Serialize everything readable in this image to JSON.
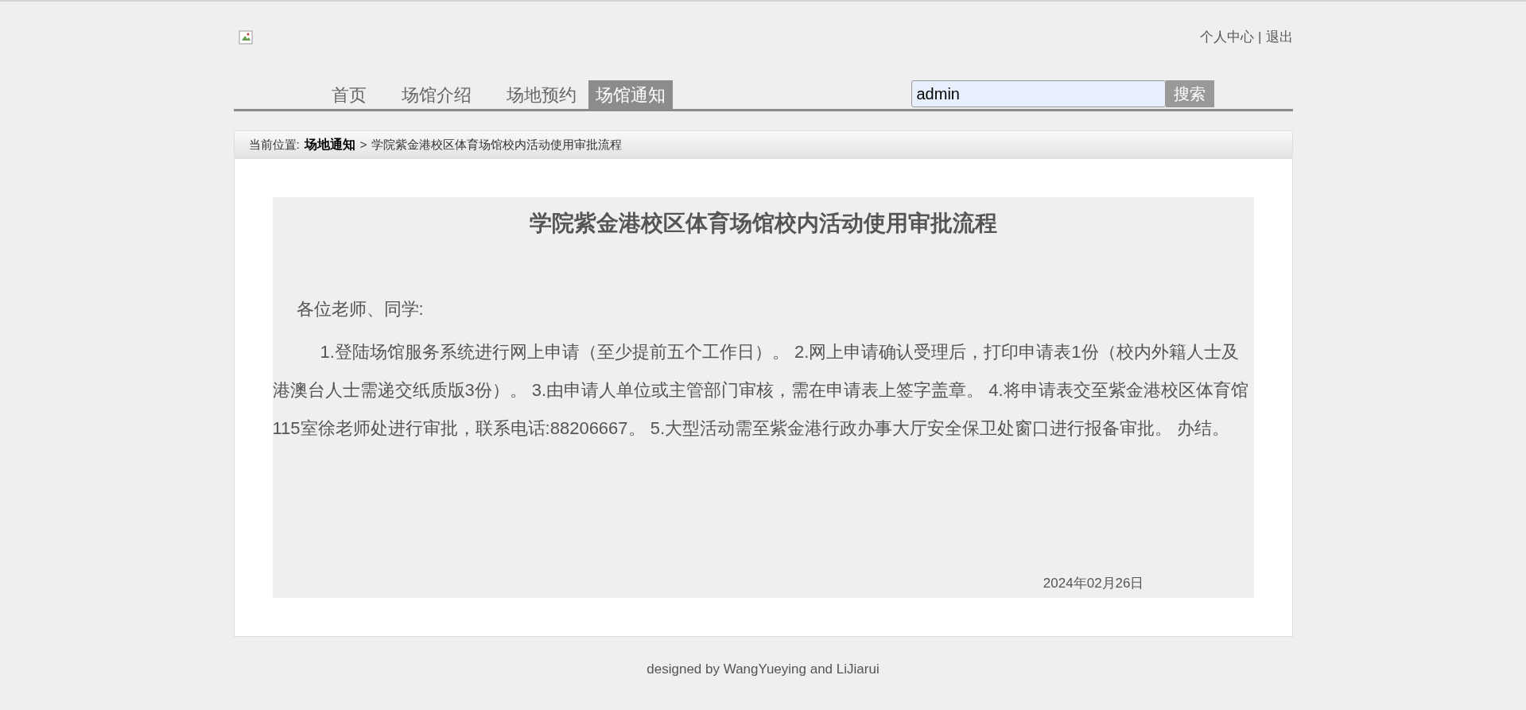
{
  "header": {
    "user_links": [
      "个人中心",
      "退出"
    ],
    "separator": "|"
  },
  "nav": {
    "items": [
      {
        "label": "首页",
        "selected": false
      },
      {
        "label": "场馆介绍",
        "selected": false
      },
      {
        "label": "场地预约",
        "selected": false
      },
      {
        "label": "场馆通知",
        "selected": true
      }
    ],
    "search": {
      "value": "admin",
      "button": "搜索"
    }
  },
  "breadcrumb": {
    "prefix": "当前位置:",
    "section": "场地通知",
    "separator": ">",
    "current": "学院紫金港校区体育场馆校内活动使用审批流程"
  },
  "article": {
    "title": "学院紫金港校区体育场馆校内活动使用审批流程",
    "greeting": "各位老师、同学:",
    "body": "1.登陆场馆服务系统进行网上申请（至少提前五个工作日）。 2.网上申请确认受理后，打印申请表1份（校内外籍人士及港澳台人士需递交纸质版3份）。 3.由申请人单位或主管部门审核，需在申请表上签字盖章。 4.将申请表交至紫金港校区体育馆115室徐老师处进行审批，联系电话:88206667。 5.大型活动需至紫金港行政办事大厅安全保卫处窗口进行报备审批。 办结。",
    "date": "2024年02月26日"
  },
  "footer": {
    "text": "designed by WangYueying and LiJiarui"
  }
}
